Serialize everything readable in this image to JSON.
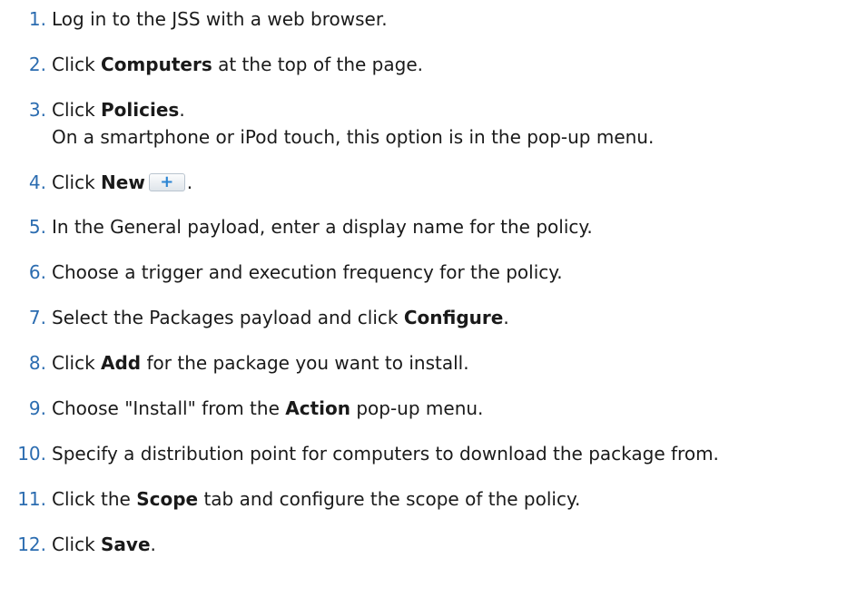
{
  "steps": [
    {
      "num": "1.",
      "text": "Log in to the JSS with a web browser."
    },
    {
      "num": "2.",
      "pre": "Click ",
      "bold": "Computers",
      "post": " at the top of the page."
    },
    {
      "num": "3.",
      "pre": "Click ",
      "bold": "Policies",
      "post": ".",
      "sub": "On a smartphone or iPod touch, this option is in the pop-up menu."
    },
    {
      "num": "4.",
      "pre": "Click ",
      "bold": "New",
      "icon_symbol": "+",
      "post": "."
    },
    {
      "num": "5.",
      "text": "In the General payload, enter a display name for the policy."
    },
    {
      "num": "6.",
      "text": "Choose a trigger and execution frequency for the policy."
    },
    {
      "num": "7.",
      "pre": "Select the Packages payload and click ",
      "bold": "Configure",
      "post": "."
    },
    {
      "num": "8.",
      "pre": "Click ",
      "bold": "Add",
      "post": " for the package you want to install."
    },
    {
      "num": "9.",
      "pre": "Choose \"Install\" from the ",
      "bold": "Action",
      "post": " pop-up menu."
    },
    {
      "num": "10.",
      "text": "Specify a distribution point for computers to download the package from."
    },
    {
      "num": "11.",
      "pre": "Click the ",
      "bold": "Scope",
      "post": " tab and configure the scope of the policy."
    },
    {
      "num": "12.",
      "pre": "Click ",
      "bold": "Save",
      "post": "."
    }
  ],
  "colors": {
    "number": "#2b6cb0",
    "text": "#1a1a1a",
    "icon": "#2a84d2"
  }
}
